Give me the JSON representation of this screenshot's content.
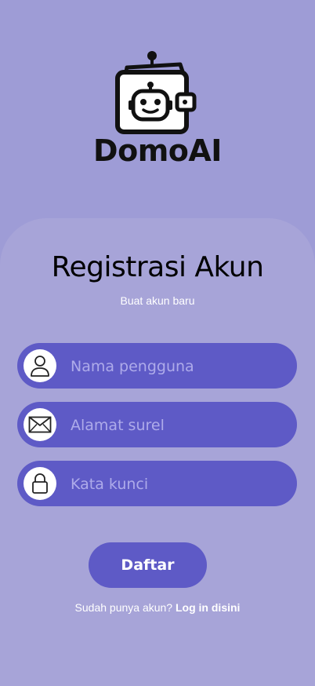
{
  "brand": {
    "name": "DomoAI"
  },
  "heading": {
    "title": "Registrasi Akun",
    "subtitle": "Buat akun baru"
  },
  "form": {
    "username": {
      "placeholder": "Nama pengguna",
      "icon": "user-icon"
    },
    "email": {
      "placeholder": "Alamat surel",
      "icon": "envelope-icon"
    },
    "password": {
      "placeholder": "Kata kunci",
      "icon": "lock-icon"
    }
  },
  "submit": {
    "label": "Daftar"
  },
  "footer": {
    "prompt": "Sudah punya akun?",
    "link": "Log in disini"
  },
  "colors": {
    "background": "#9e9cd6",
    "card": "#a7a4d8",
    "accent": "#5e5ac6"
  }
}
